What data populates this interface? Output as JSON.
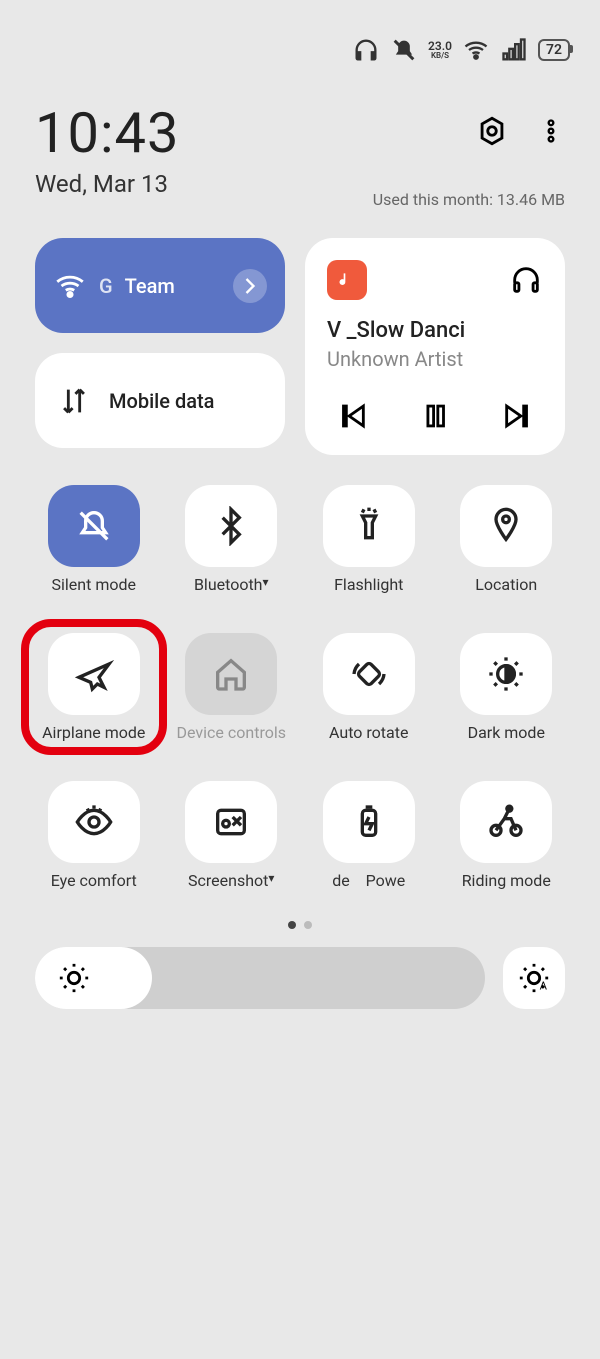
{
  "status": {
    "speed_value": "23.0",
    "speed_unit": "KB/S",
    "battery": "72"
  },
  "header": {
    "time": "10:43",
    "date": "Wed, Mar 13",
    "usage": "Used this month: 13.46 MB"
  },
  "wifi": {
    "prefix": "G",
    "ssid": "Team"
  },
  "mobile_data": {
    "label": "Mobile data"
  },
  "media": {
    "title": "V _Slow Danci",
    "artist": "Unknown Artist"
  },
  "tiles": [
    {
      "label": "Silent mode",
      "active": true,
      "icon": "bell-off"
    },
    {
      "label": "Bluetooth",
      "caret": true,
      "icon": "bluetooth"
    },
    {
      "label": "Flashlight",
      "icon": "flashlight"
    },
    {
      "label": "Location",
      "icon": "location"
    },
    {
      "label": "Airplane mode",
      "highlight": true,
      "icon": "airplane"
    },
    {
      "label": "Device controls",
      "dim": true,
      "icon": "home"
    },
    {
      "label": "Auto rotate",
      "icon": "rotate"
    },
    {
      "label": "Dark mode",
      "icon": "dark"
    },
    {
      "label": "Eye comfort",
      "icon": "eye"
    },
    {
      "label": "Screenshot",
      "caret": true,
      "icon": "screenshot"
    },
    {
      "label": "de    Powe",
      "icon": "battery"
    },
    {
      "label": "Riding mode",
      "icon": "bike"
    }
  ],
  "pagination": {
    "current": 0,
    "total": 2
  },
  "brightness": {
    "percent": 26
  }
}
